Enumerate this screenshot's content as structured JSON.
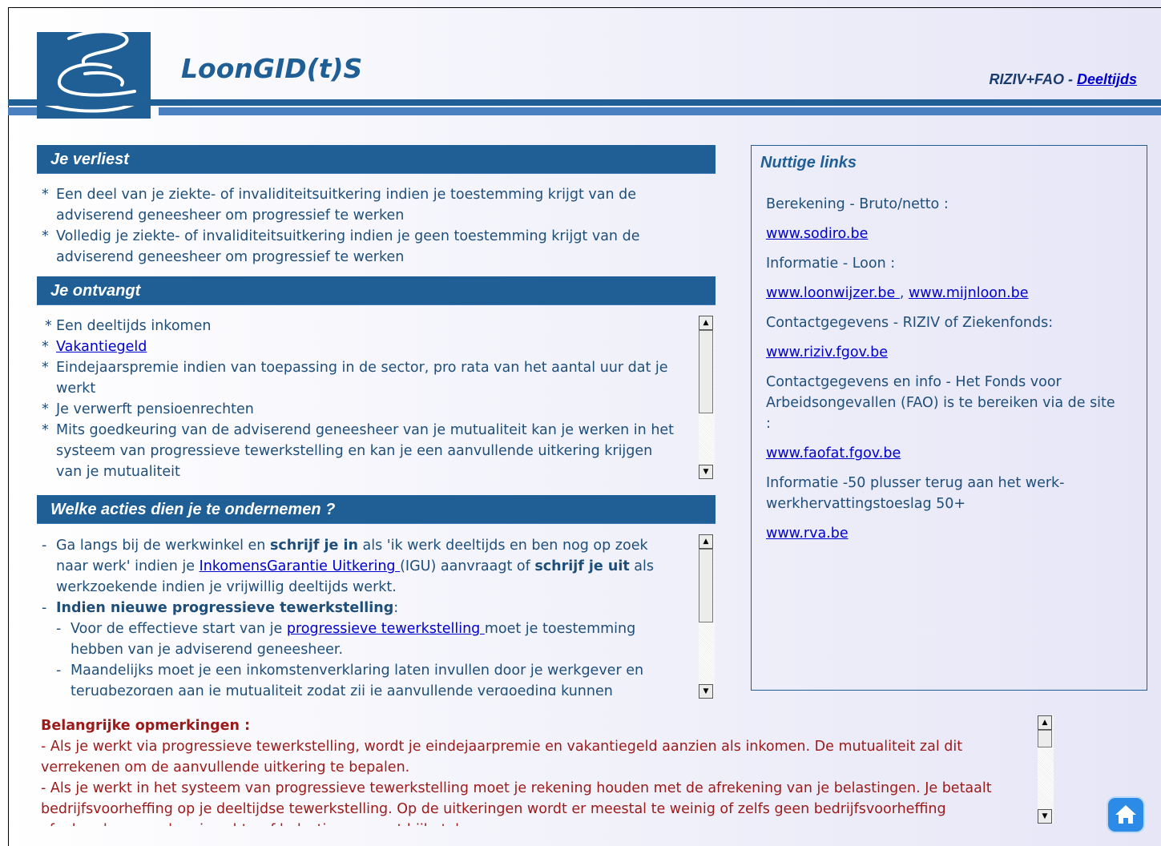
{
  "header": {
    "app_title": "LoonGID(t)S",
    "tagline_prefix": "RIZIV+FAO - ",
    "tagline_link": "Deeltijds"
  },
  "section_loss": {
    "title": "Je verliest",
    "items": [
      "Een deel van je ziekte- of invaliditeitsuitkering indien je toestemming krijgt  van de adviserend geneesheer om progressief te werken",
      "Volledig je ziekte- of invaliditeitsuitkering indien je geen toestemming krijgt van de adviserend geneesheer om progressief te werken"
    ]
  },
  "section_receive": {
    "title": "Je ontvangt",
    "item1": "Een deeltijds inkomen",
    "item2_link": "Vakantiegeld ",
    "item3": "Eindejaarspremie indien van toepassing in de sector, pro rata van het aantal uur dat je werkt",
    "item4": "Je verwerft pensioenrechten",
    "item5": "Mits goedkeuring van de adviserend geneesheer van je mutualiteit kan je werken in het systeem van progressieve tewerkstelling en kan je een aanvullende uitkering krijgen van je mutualiteit"
  },
  "section_actions": {
    "title": "Welke acties dien je te ondernemen ?",
    "p1_a": "Ga langs bij de werkwinkel en ",
    "p1_b": "schrijf je in",
    "p1_c": " als 'ik werk deeltijds en ben nog op zoek naar werk' indien je ",
    "p1_link": "InkomensGarantie Uitkering ",
    "p1_d": "(IGU) aanvraagt of ",
    "p1_e": "schrijf je uit",
    "p1_f": " als werkzoekende indien je vrijwillig deeltijds werkt.",
    "p2": "Indien nieuwe progressieve tewerkstelling",
    "p2_colon": ":",
    "p3_a": "Voor de effectieve start van je ",
    "p3_link": "progressieve tewerkstelling ",
    "p3_b": "moet je toestemming hebben van je adviserend geneesheer.",
    "p4": "Maandelijks moet je een inkomstenverklaring laten invullen door je werkgever en terugbezorgen aan je mutualiteit zodat zij je aanvullende vergoeding kunnen berekenen."
  },
  "links_panel": {
    "title": "Nuttige links",
    "l1": "Berekening - Bruto/netto  :",
    "u1": "www.sodiro.be ",
    "l2": "Informatie - Loon :",
    "u2a": "www.loonwijzer.be ",
    "sep": ", ",
    "u2b": "www.mijnloon.be ",
    "l3": "Contactgegevens - RIZIV of Ziekenfonds:",
    "u3": "www.riziv.fgov.be ",
    "l4": "Contactgegevens en info - Het Fonds voor Arbeidsongevallen (FAO) is te bereiken via de site :",
    "u4": "www.faofat.fgov.be ",
    "l5": "Informatie -50 plusser terug aan het werk-werkhervattingstoeslag 50+",
    "u5": "www.rva.be "
  },
  "remarks": {
    "title": "Belangrijke opmerkingen :",
    "r1": "-  Als je werkt via progressieve tewerkstelling, wordt je eindejaarpremie en vakantiegeld aanzien als inkomen. De mutualiteit zal dit verrekenen om de aanvullende uitkering te bepalen.",
    "r2": "-  Als je werkt in het systeem van progressieve tewerkstelling moet je rekening houden met de afrekening van je belastingen. Je betaalt bedrijfsvoorheffing op je deeltijdse tewerkstelling. Op de uitkeringen wordt er meestal te weinig of zelfs geen bedrijfsvoorheffing afgehouden waardoor je achteraf belastingen moet bijbetalen."
  },
  "icons": {
    "scroll_up": "arrow-up-icon",
    "scroll_down": "arrow-down-icon",
    "home": "home-icon"
  }
}
